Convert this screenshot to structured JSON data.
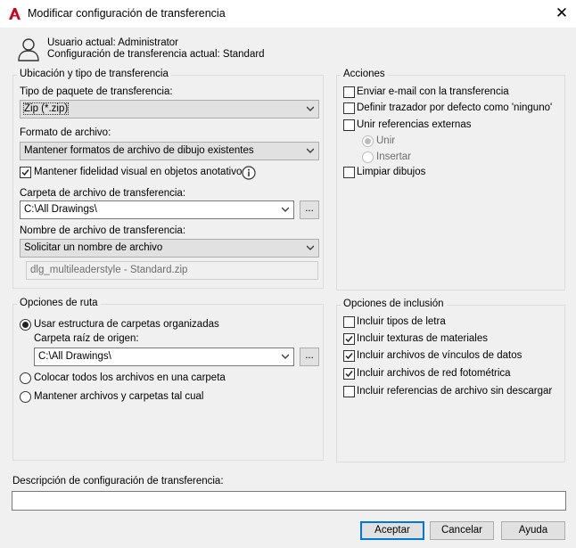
{
  "window": {
    "title": "Modificar configuración de transferencia",
    "close_glyph": "✕"
  },
  "user_info": {
    "user": "Usuario actual: Administrator",
    "config": "Configuración de transferencia actual: Standard"
  },
  "location_group": {
    "title": "Ubicación y tipo de transferencia",
    "package_type_label": "Tipo de paquete de transferencia:",
    "package_type_value": "Zip (*.zip)",
    "file_format_label": "Formato de archivo:",
    "file_format_value": "Mantener formatos de archivo de dibujo existentes",
    "visual_fidelity_label": "Mantener fidelidad visual en objetos anotativos",
    "visual_fidelity_checked": true,
    "folder_label": "Carpeta de archivo de transferencia:",
    "folder_value": "C:\\All Drawings\\",
    "browse_label": "...",
    "filename_label": "Nombre de archivo de transferencia:",
    "filename_value": "Solicitar un nombre de archivo",
    "filename_preview": "dlg_multileaderstyle - Standard.zip"
  },
  "actions_group": {
    "title": "Acciones",
    "send_email": "Enviar e-mail con la transferencia",
    "default_plotter": "Definir trazador por defecto como 'ninguno'",
    "bind_xrefs": "Unir referencias externas",
    "bind_option": "Unir",
    "insert_option": "Insertar",
    "purge": "Limpiar dibujos"
  },
  "path_group": {
    "title": "Opciones de ruta",
    "organized": "Usar estructura de carpetas organizadas",
    "root_label": "Carpeta raíz de origen:",
    "root_value": "C:\\All Drawings\\",
    "browse_label": "...",
    "single_folder": "Colocar todos los archivos en una carpeta",
    "keep_as_is": "Mantener archivos y carpetas tal cual"
  },
  "include_group": {
    "title": "Opciones de inclusión",
    "fonts": {
      "label": "Incluir tipos de letra",
      "checked": false
    },
    "materials": {
      "label": "Incluir texturas de materiales",
      "checked": true
    },
    "data_links": {
      "label": "Incluir archivos de vínculos de datos",
      "checked": true
    },
    "photometric": {
      "label": "Incluir archivos de red fotométrica",
      "checked": true
    },
    "unloaded": {
      "label": "Incluir referencias de archivo sin descargar",
      "checked": false
    }
  },
  "description": {
    "label": "Descripción de configuración de transferencia:",
    "value": ""
  },
  "buttons": {
    "accept": "Aceptar",
    "cancel": "Cancelar",
    "help": "Ayuda"
  },
  "colors": {
    "accent": "#0078d7",
    "logo_red": "#d0021b"
  }
}
